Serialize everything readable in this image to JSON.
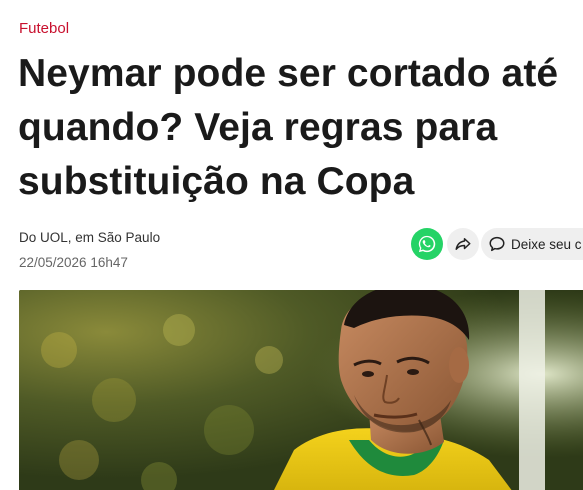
{
  "article": {
    "category": "Futebol",
    "headline_lines": [
      "Neymar pode ser cortado até",
      "quando? Veja regras para",
      "substituição na Copa"
    ],
    "byline": "Do UOL, em São Paulo",
    "date": "22/05/2026 16h47"
  },
  "actions": {
    "whatsapp_icon": "whatsapp-icon",
    "share_icon": "share-arrow-icon",
    "comment_icon": "comment-bubble-icon",
    "comment_label": "Deixe seu c"
  },
  "photo": {
    "subject": "neymar-photo"
  },
  "colors": {
    "category": "#c8102e",
    "headline": "#1a1a1a",
    "whatsapp": "#25d366",
    "button_bg": "#efefef"
  }
}
